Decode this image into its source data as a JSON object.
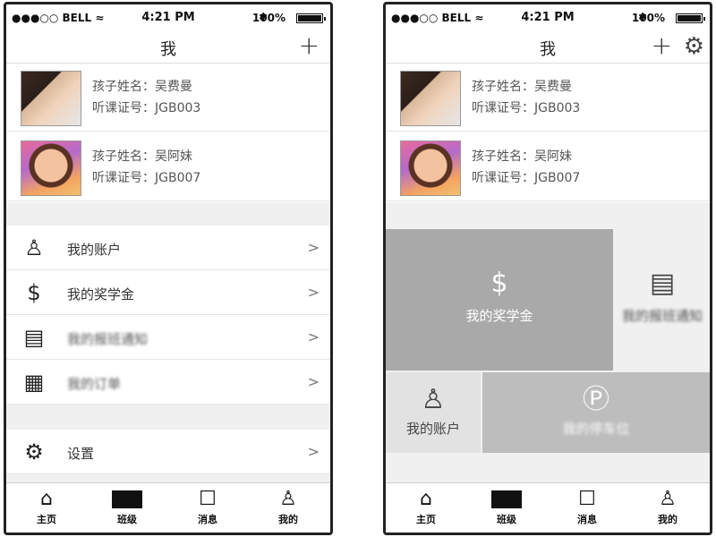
{
  "status_bar": {
    "signal": "●●●○○ BELL ≈",
    "time": "4:21 PM",
    "bluetooth": "✱",
    "battery": "100%"
  },
  "header": {
    "title": "我",
    "add_icon": "+",
    "settings_icon": "⚙"
  },
  "children": [
    {
      "name": "孩子姓名：吴费曼",
      "cert": "听课证号：JGB003"
    },
    {
      "name": "孩子姓名：吴阿妹",
      "cert": "听课证号：JGB007"
    }
  ],
  "left_menu": [
    {
      "icon": "person-icon",
      "label": "我的账户",
      "chevron": ">"
    },
    {
      "icon": "money-bag-icon",
      "label": "我的奖学金",
      "chevron": ">"
    },
    {
      "icon": "notebook-icon",
      "label": "我的报班通知",
      "chevron": ">",
      "blurred": true
    },
    {
      "icon": "document-icon",
      "label": "我的订单",
      "chevron": ">",
      "blurred": true
    },
    {
      "icon": "gear-icon",
      "label": "设置",
      "chevron": ">"
    }
  ],
  "right_tiles": [
    {
      "icon": "money-bag-icon",
      "label": "我的奖学金",
      "color": "#a9a9a9"
    },
    {
      "icon": "notebook-icon",
      "label": "我的报班通知",
      "color": "#f0f0f0",
      "blurred": true
    },
    {
      "icon": "person-icon",
      "label": "我的账户",
      "color": "#e2e2e2"
    },
    {
      "icon": "parking-icon",
      "label": "我的停车位",
      "color": "#bdbdbd",
      "blurred": true
    }
  ],
  "tabs": [
    {
      "icon": "home-icon",
      "label": "主页"
    },
    {
      "icon": "class-icon",
      "label": "班级"
    },
    {
      "icon": "message-icon",
      "label": "消息"
    },
    {
      "icon": "mine-icon",
      "label": "我的"
    }
  ]
}
